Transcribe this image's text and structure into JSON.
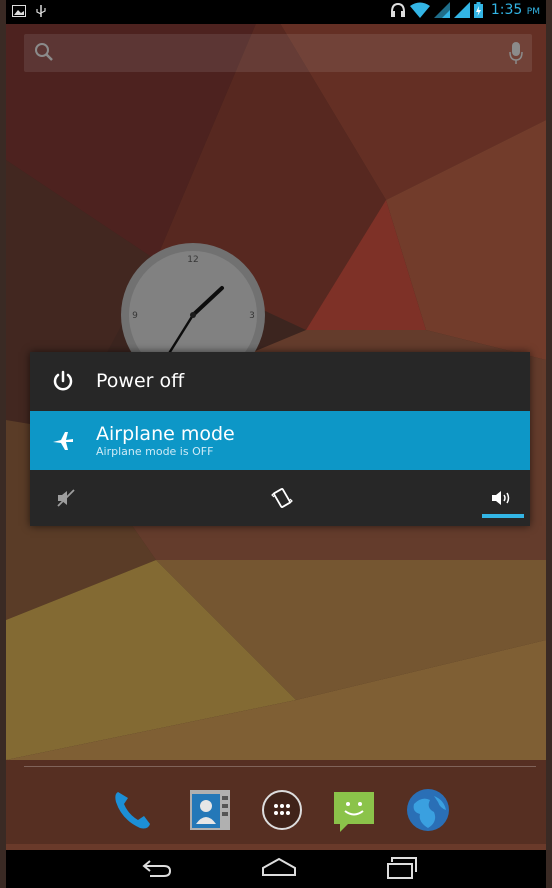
{
  "status_bar": {
    "time": "1:35",
    "ampm": "PM",
    "icons": [
      "gallery-icon",
      "usb-icon",
      "headset-icon",
      "wifi-icon",
      "signal-icon",
      "signal-icon",
      "battery-icon"
    ]
  },
  "search": {
    "icons": [
      "search-icon",
      "mic-icon"
    ]
  },
  "clock_widget": {
    "numbers": [
      "12",
      "3",
      "9"
    ]
  },
  "power_dialog": {
    "power_off_label": "Power off",
    "airplane_label": "Airplane mode",
    "airplane_status": "Airplane mode is OFF",
    "sound_modes": [
      "silent",
      "vibrate",
      "sound"
    ],
    "selected_sound_mode": "sound"
  },
  "dock": {
    "apps": [
      "phone",
      "contacts",
      "all-apps",
      "messaging",
      "browser"
    ]
  },
  "nav_bar": {
    "buttons": [
      "back",
      "home",
      "recent-apps"
    ]
  },
  "colors": {
    "accent": "#33b5e5",
    "airplane_row": "#0d97c7",
    "dialog_bg": "#272727"
  }
}
